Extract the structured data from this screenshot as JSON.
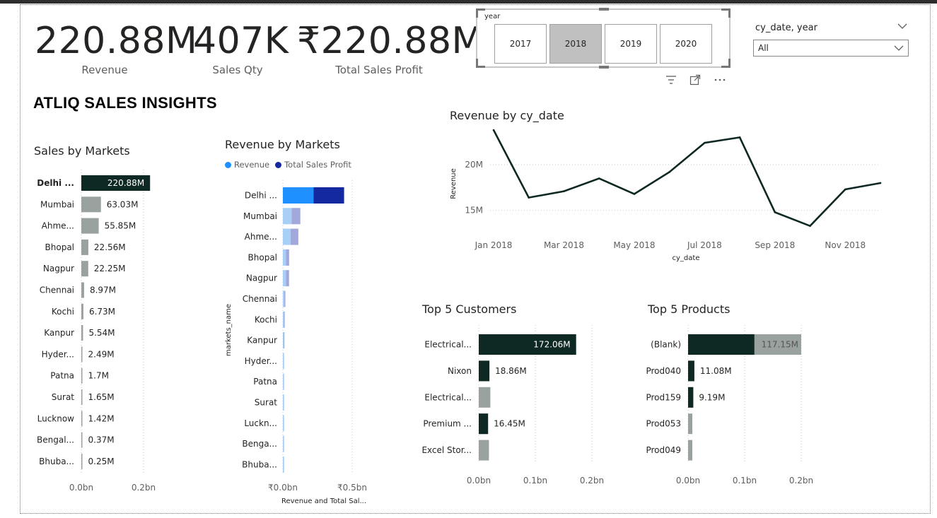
{
  "kpis": [
    {
      "value": "220.88M",
      "label": "Revenue"
    },
    {
      "value": "407K",
      "label": "Sales Qty"
    },
    {
      "value": "₹220.88M",
      "label": "Total Sales Profit"
    }
  ],
  "main_title": "ATLIQ SALES INSIGHTS",
  "year_slicer": {
    "caption": "year",
    "years": [
      "2017",
      "2018",
      "2019",
      "2020"
    ],
    "selected": "2018"
  },
  "date_dropdown": {
    "label": "cy_date, year",
    "value": "All"
  },
  "visual_header_icons": [
    "filter-icon",
    "focus-mode-icon",
    "more-options-icon"
  ],
  "colors": {
    "dark": "#0e2823",
    "gray": "#9aa2a0",
    "blue_light": "#1e90ff",
    "blue_dark": "#1428a0"
  },
  "chart_data": [
    {
      "id": "sales_by_markets",
      "type": "bar",
      "orientation": "horizontal",
      "title": "Sales by Markets",
      "categories": [
        "Delhi ...",
        "Mumbai",
        "Ahme...",
        "Bhopal",
        "Nagpur",
        "Chennai",
        "Kochi",
        "Kanpur",
        "Hyder...",
        "Patna",
        "Surat",
        "Lucknow",
        "Bengal...",
        "Bhuba..."
      ],
      "values": [
        220.88,
        63.03,
        55.85,
        22.56,
        22.25,
        8.97,
        6.73,
        5.54,
        2.49,
        1.7,
        1.65,
        1.42,
        0.37,
        0.25
      ],
      "data_labels": [
        "220.88M",
        "63.03M",
        "55.85M",
        "22.56M",
        "22.25M",
        "8.97M",
        "6.73M",
        "5.54M",
        "2.49M",
        "1.7M",
        "1.65M",
        "1.42M",
        "0.37M",
        "0.25M"
      ],
      "unit": "M",
      "xlim": [
        0,
        0.2
      ],
      "x_ticks": [
        "0.0bn",
        "0.2bn"
      ],
      "highlighted": "Delhi ..."
    },
    {
      "id": "revenue_by_markets",
      "type": "bar",
      "orientation": "horizontal",
      "stacked": true,
      "title": "Revenue by Markets",
      "ylabel": "markets_name",
      "xlabel": "Revenue and Total Sal...",
      "categories": [
        "Delhi ...",
        "Mumbai",
        "Ahme...",
        "Bhopal",
        "Nagpur",
        "Chennai",
        "Kochi",
        "Kanpur",
        "Hyder...",
        "Patna",
        "Surat",
        "Luckn...",
        "Benga...",
        "Bhuba..."
      ],
      "series": [
        {
          "name": "Revenue",
          "values": [
            220.88,
            63.03,
            55.85,
            22.56,
            22.25,
            8.97,
            6.73,
            5.54,
            2.49,
            1.7,
            1.65,
            1.42,
            0.37,
            0.25
          ]
        },
        {
          "name": "Total Sales Profit",
          "values": [
            220.88,
            63.03,
            55.85,
            22.56,
            22.25,
            8.97,
            6.73,
            5.54,
            2.49,
            1.7,
            1.65,
            1.42,
            0.37,
            0.25
          ]
        }
      ],
      "xlim": [
        0,
        0.5
      ],
      "x_ticks": [
        "₹0.0bn",
        "₹0.5bn"
      ],
      "legend": "top-left",
      "highlighted": "Delhi ..."
    },
    {
      "id": "revenue_by_cy_date",
      "type": "line",
      "title": "Revenue by cy_date",
      "xlabel": "cy_date",
      "ylabel": "Revenue",
      "x": [
        "2018-01",
        "2018-02",
        "2018-03",
        "2018-04",
        "2018-05",
        "2018-06",
        "2018-07",
        "2018-08",
        "2018-09",
        "2018-10",
        "2018-11",
        "2018-12"
      ],
      "y": [
        23.8,
        16.4,
        17.1,
        18.5,
        16.8,
        19.2,
        22.4,
        23.0,
        14.8,
        13.3,
        17.3,
        18.0
      ],
      "x_ticks": [
        "Jan 2018",
        "Mar 2018",
        "May 2018",
        "Jul 2018",
        "Sep 2018",
        "Nov 2018"
      ],
      "y_ticks": [
        "15M",
        "20M"
      ],
      "ylim": [
        12.5,
        24.5
      ],
      "grid": true
    },
    {
      "id": "top5_customers",
      "type": "bar",
      "orientation": "horizontal",
      "title": "Top 5 Customers",
      "categories": [
        "Electrical...",
        "Nixon",
        "Electrical...",
        "Premium ...",
        "Excel Stor..."
      ],
      "values": [
        172.06,
        18.86,
        20.5,
        16.45,
        18.0
      ],
      "highlight_values": [
        172.06,
        18.86,
        0,
        16.45,
        0
      ],
      "data_labels": [
        "172.06M",
        "18.86M",
        "",
        "16.45M",
        ""
      ],
      "xlim": [
        0,
        0.2
      ],
      "x_ticks": [
        "0.0bn",
        "0.1bn",
        "0.2bn"
      ]
    },
    {
      "id": "top5_products",
      "type": "bar",
      "orientation": "horizontal",
      "title": "Top 5 Products",
      "categories": [
        "(Blank)",
        "Prod040",
        "Prod159",
        "Prod053",
        "Prod049"
      ],
      "values": [
        200,
        11.08,
        9.19,
        7.5,
        7.5
      ],
      "highlight_values": [
        117.15,
        11.08,
        9.19,
        0,
        0
      ],
      "data_labels": [
        "117.15M",
        "11.08M",
        "9.19M",
        "",
        ""
      ],
      "xlim": [
        0,
        0.2
      ],
      "x_ticks": [
        "0.0bn",
        "0.1bn",
        "0.2bn"
      ]
    }
  ]
}
